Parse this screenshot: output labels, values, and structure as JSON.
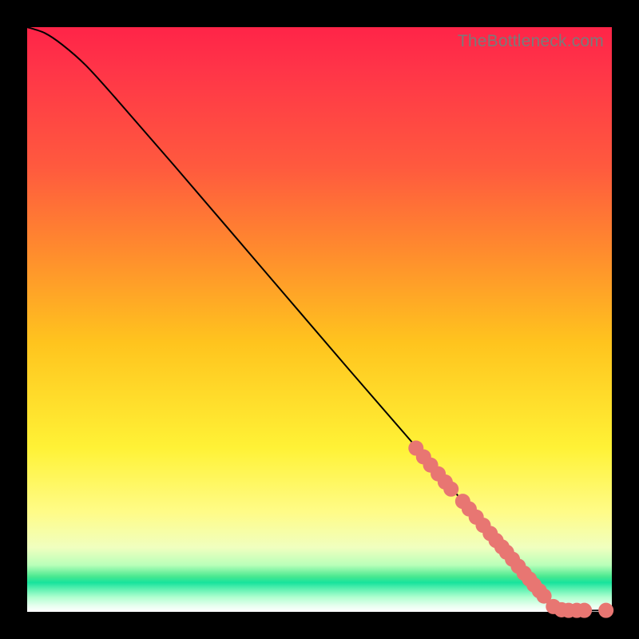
{
  "watermark": "TheBottleneck.com",
  "chart_data": {
    "type": "line",
    "title": "",
    "xlabel": "",
    "ylabel": "",
    "xlim": [
      0,
      100
    ],
    "ylim": [
      0,
      100
    ],
    "curve": {
      "description": "Smooth decreasing curve from top-left corner, slight initial convex bulge, then near-linear descent to bottom-right where it flattens to zero.",
      "points": [
        {
          "x": 0,
          "y": 100
        },
        {
          "x": 3,
          "y": 99
        },
        {
          "x": 6,
          "y": 97
        },
        {
          "x": 10,
          "y": 93.5
        },
        {
          "x": 15,
          "y": 88
        },
        {
          "x": 25,
          "y": 76.5
        },
        {
          "x": 40,
          "y": 59
        },
        {
          "x": 55,
          "y": 41.5
        },
        {
          "x": 68,
          "y": 26.5
        },
        {
          "x": 78,
          "y": 14.8
        },
        {
          "x": 83,
          "y": 9
        },
        {
          "x": 87,
          "y": 4.3
        },
        {
          "x": 89.5,
          "y": 1.4
        },
        {
          "x": 90.5,
          "y": 0.6
        },
        {
          "x": 92,
          "y": 0.25
        },
        {
          "x": 100,
          "y": 0.25
        }
      ]
    },
    "scatter": {
      "description": "Salmon circular markers clustered along the lower segment of the curve and along the flat tail.",
      "r_fraction": 0.013,
      "points": [
        {
          "x": 66.5,
          "y": 28.0
        },
        {
          "x": 67.8,
          "y": 26.5
        },
        {
          "x": 69.0,
          "y": 25.1
        },
        {
          "x": 70.3,
          "y": 23.6
        },
        {
          "x": 71.5,
          "y": 22.2
        },
        {
          "x": 72.5,
          "y": 21.0
        },
        {
          "x": 74.5,
          "y": 18.9
        },
        {
          "x": 75.6,
          "y": 17.6
        },
        {
          "x": 76.8,
          "y": 16.2
        },
        {
          "x": 78.0,
          "y": 14.8
        },
        {
          "x": 79.2,
          "y": 13.4
        },
        {
          "x": 80.2,
          "y": 12.2
        },
        {
          "x": 81.2,
          "y": 11.1
        },
        {
          "x": 82.0,
          "y": 10.2
        },
        {
          "x": 83.0,
          "y": 9.0
        },
        {
          "x": 84.0,
          "y": 7.8
        },
        {
          "x": 85.0,
          "y": 6.6
        },
        {
          "x": 85.9,
          "y": 5.6
        },
        {
          "x": 86.7,
          "y": 4.6
        },
        {
          "x": 87.6,
          "y": 3.6
        },
        {
          "x": 88.4,
          "y": 2.7
        },
        {
          "x": 90.0,
          "y": 0.9
        },
        {
          "x": 91.4,
          "y": 0.35
        },
        {
          "x": 92.6,
          "y": 0.25
        },
        {
          "x": 94.0,
          "y": 0.25
        },
        {
          "x": 95.3,
          "y": 0.25
        },
        {
          "x": 99.0,
          "y": 0.25
        }
      ]
    }
  }
}
